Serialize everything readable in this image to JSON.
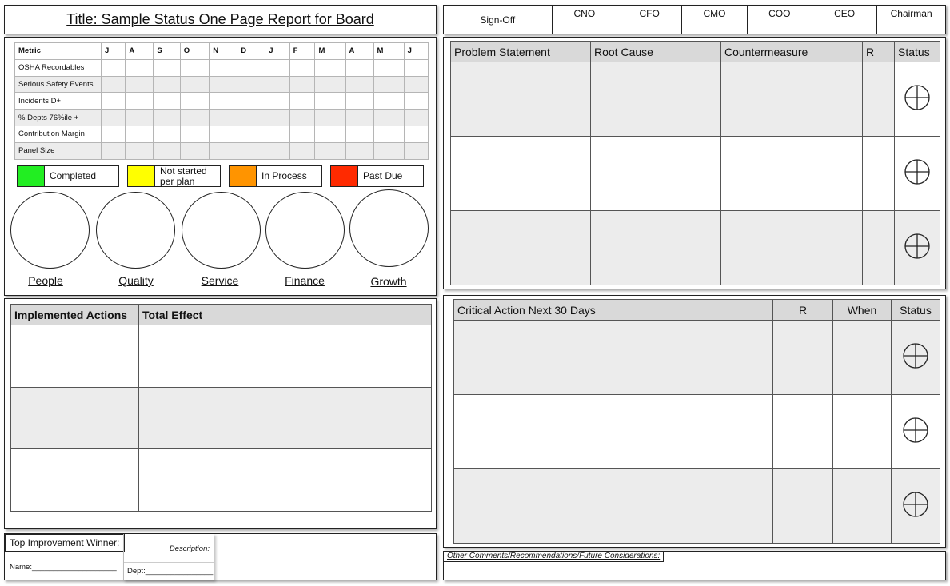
{
  "title": "Title:  Sample Status One Page Report for Board",
  "signoff": {
    "label": "Sign-Off",
    "roles": [
      "CNO",
      "CFO",
      "CMO",
      "COO",
      "CEO",
      "Chairman"
    ]
  },
  "metrics": {
    "header": "Metric",
    "months": [
      "J",
      "A",
      "S",
      "O",
      "N",
      "D",
      "J",
      "F",
      "M",
      "A",
      "M",
      "J"
    ],
    "rows": [
      "OSHA Recordables",
      "Serious Safety Events",
      "Incidents D+",
      "% Depts 76%ile +",
      "Contribution Margin",
      "Panel Size"
    ]
  },
  "legend": [
    {
      "label": "Completed",
      "color": "#22ee22"
    },
    {
      "label": "Not started per plan",
      "color": "#ffff00"
    },
    {
      "label": "In Process",
      "color": "#ff9400"
    },
    {
      "label": "Past Due",
      "color": "#ff2a00"
    }
  ],
  "categories": [
    "People",
    "Quality",
    "Service",
    "Finance",
    "Growth"
  ],
  "implemented": {
    "col1": "Implemented Actions",
    "col2": "Total Effect"
  },
  "winner": {
    "title": "Top Improvement Winner:",
    "name": "Name:____________________",
    "description": "Description:",
    "dept": "Dept:________________"
  },
  "problem": {
    "headers": [
      "Problem Statement",
      "Root Cause",
      "Countermeasure",
      "R",
      "Status"
    ]
  },
  "critical": {
    "headers": [
      "Critical Action Next 30 Days",
      "R",
      "When",
      "Status"
    ]
  },
  "comments": {
    "label": "Other Comments/Recommendations/Future Considerations:"
  }
}
